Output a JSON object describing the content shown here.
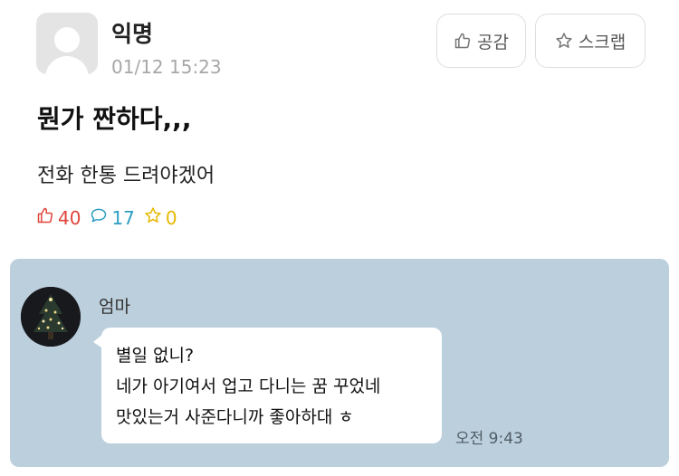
{
  "post": {
    "author": "익명",
    "timestamp": "01/12 15:23",
    "title": "뭔가 짠하다,,,",
    "body": "전화 한통 드려야겠어"
  },
  "buttons": {
    "like_label": "공감",
    "scrap_label": "스크랩"
  },
  "stats": {
    "likes": "40",
    "comments": "17",
    "scraps": "0"
  },
  "chat": {
    "sender": "엄마",
    "message_lines": [
      "별일 없니?",
      "네가 아기여서 업고 다니는 꿈 꾸었네",
      "맛있는거 사준다니까 좋아하대 ㅎ"
    ],
    "time": "오전 9:43"
  },
  "colors": {
    "likes": "#e0443a",
    "comments": "#2c9ec2",
    "scraps": "#e6b800",
    "chat_background": "#bccfdc"
  }
}
